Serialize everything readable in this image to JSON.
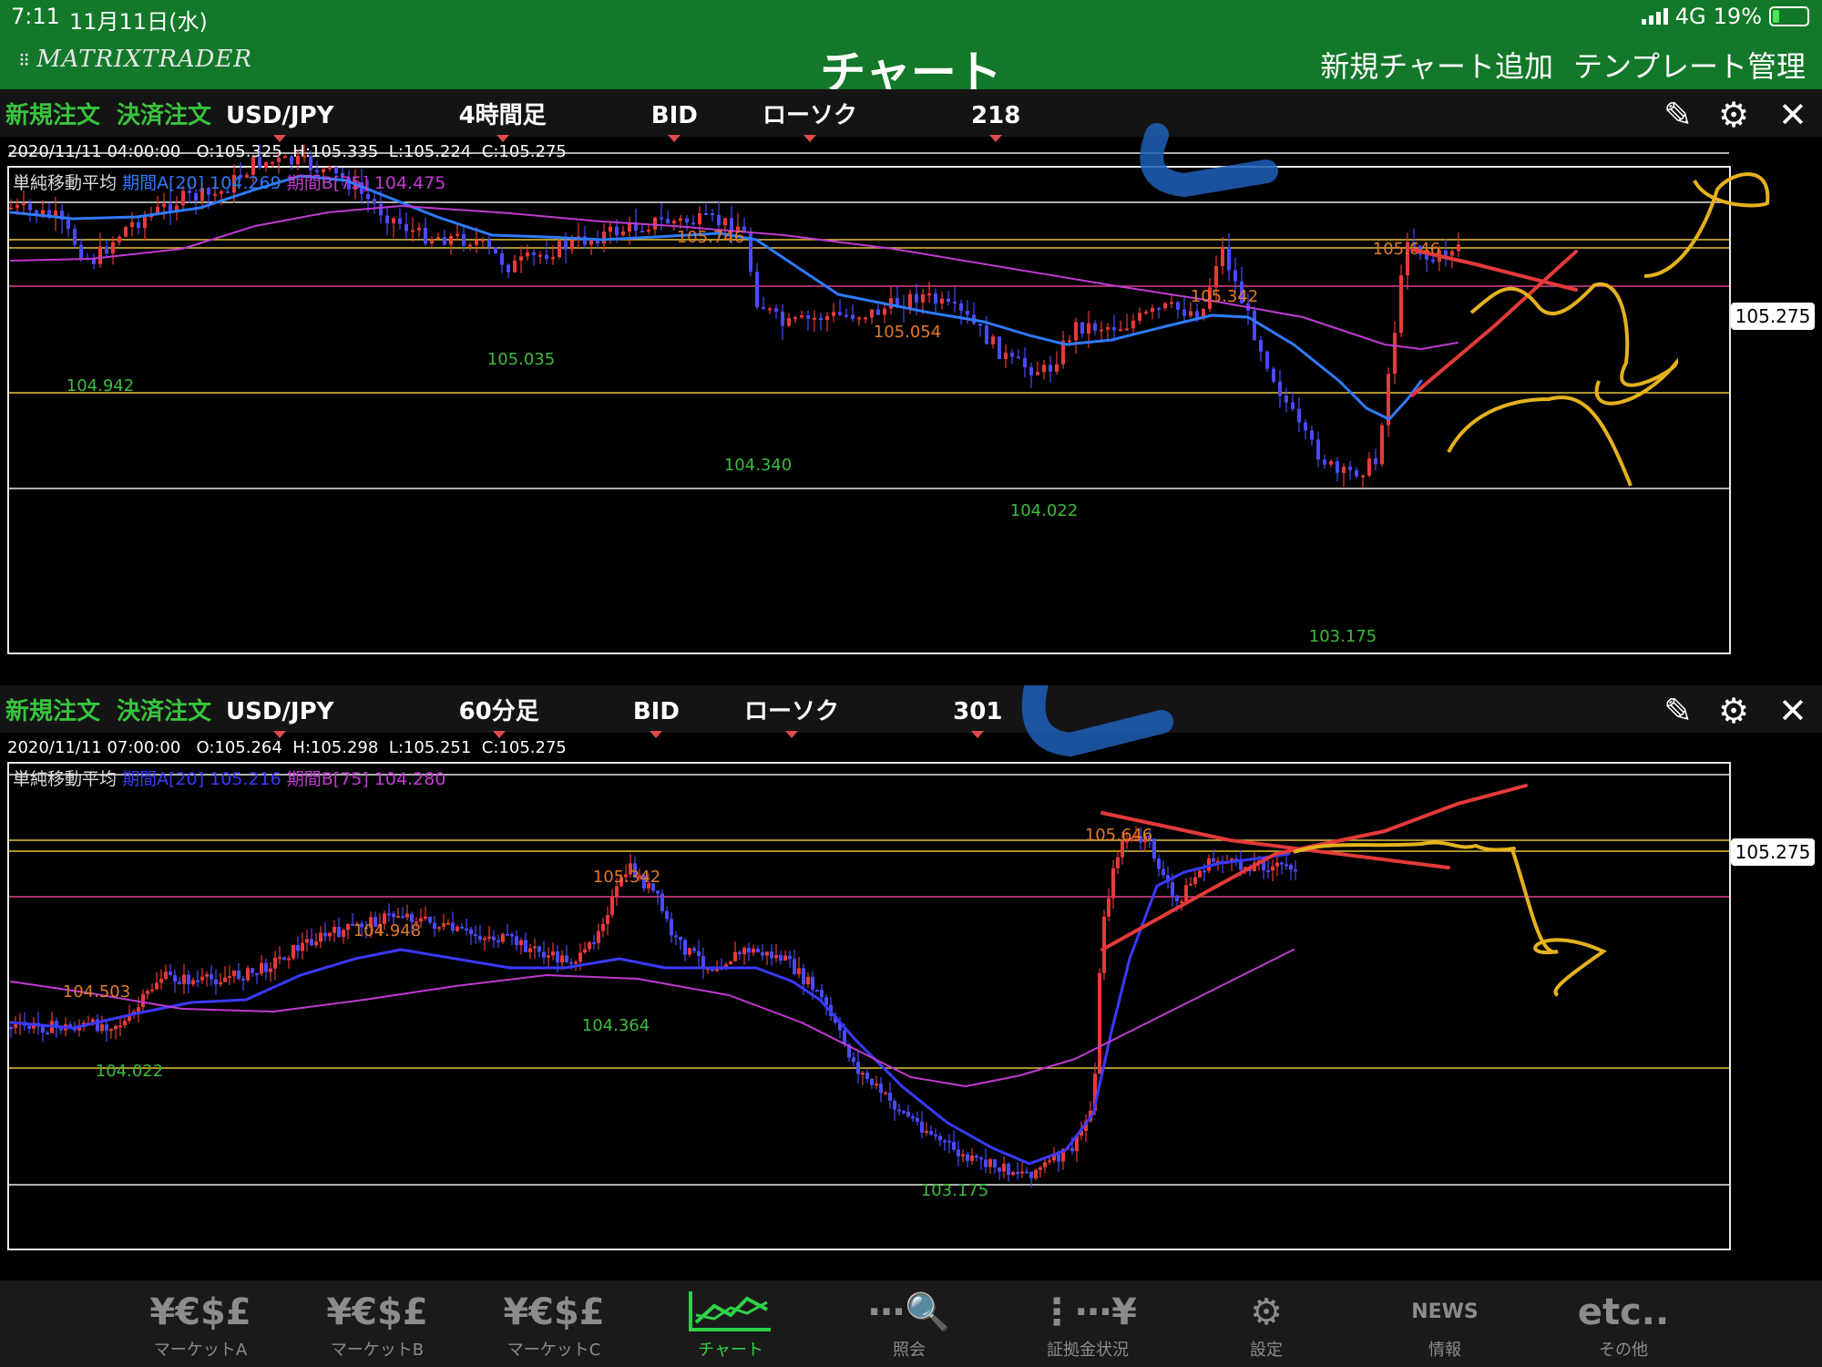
{
  "status": {
    "time": "7:11",
    "date": "11月11日(水)",
    "network": "4G",
    "battery": "19%"
  },
  "header": {
    "logo": "MATRIXTRADER",
    "title": "チャート",
    "add_chart": "新規チャート追加",
    "template": "テンプレート管理"
  },
  "panels": [
    {
      "new_order": "新規注文",
      "settle_order": "決済注文",
      "pair": "USD/JPY",
      "timeframe": "4時間足",
      "side": "BID",
      "style": "ローソク",
      "count": "218",
      "ohlc_time": "2020/11/11 04:00:00",
      "ohlc_o": "O:105.325",
      "ohlc_h": "H:105.335",
      "ohlc_l": "L:105.224",
      "ohlc_c": "C:105.275",
      "sma_label": "単純移動平均",
      "sma_a": "期間A[20] 104.269",
      "sma_b": "期間B[75] 104.475",
      "price_tag": "105.275",
      "highs": [
        "105.746",
        "105.054",
        "105.342",
        "105.646"
      ],
      "lows": [
        "104.942",
        "105.035",
        "104.340",
        "104.022",
        "103.175"
      ]
    },
    {
      "new_order": "新規注文",
      "settle_order": "決済注文",
      "pair": "USD/JPY",
      "timeframe": "60分足",
      "side": "BID",
      "style": "ローソク",
      "count": "301",
      "ohlc_time": "2020/11/11 07:00:00",
      "ohlc_o": "O:105.264",
      "ohlc_h": "H:105.298",
      "ohlc_l": "L:105.251",
      "ohlc_c": "C:105.275",
      "sma_label": "単純移動平均",
      "sma_a": "期間A[20] 105.216",
      "sma_b": "期間B[75] 104.280",
      "price_tag": "105.275",
      "highs": [
        "105.342",
        "104.948",
        "104.503",
        "105.646"
      ],
      "lows": [
        "104.364",
        "104.022",
        "103.175"
      ]
    }
  ],
  "colors": {
    "header_green": "#13782a",
    "up": "#e83a3a",
    "down": "#4a4aff",
    "sma_a": "#2f7bff",
    "sma_b": "#c03ad0",
    "high_label": "#e07a2a",
    "low_label": "#3dbb3d",
    "line_yellow": "#e5c23a",
    "line_magenta": "#e0408f"
  },
  "tabs": [
    {
      "icon": "¥€$£",
      "label": "マーケットA"
    },
    {
      "icon": "¥€$£",
      "label": "マーケットB"
    },
    {
      "icon": "¥€$£",
      "label": "マーケットC"
    },
    {
      "icon": "chart-icon",
      "label": "チャート"
    },
    {
      "icon": "search-icon",
      "label": "照会"
    },
    {
      "icon": "margin-icon",
      "label": "証拠金状況"
    },
    {
      "icon": "gear-icon",
      "label": "設定"
    },
    {
      "icon": "NEWS",
      "label": "情報"
    },
    {
      "icon": "etc..",
      "label": "その他"
    }
  ]
}
